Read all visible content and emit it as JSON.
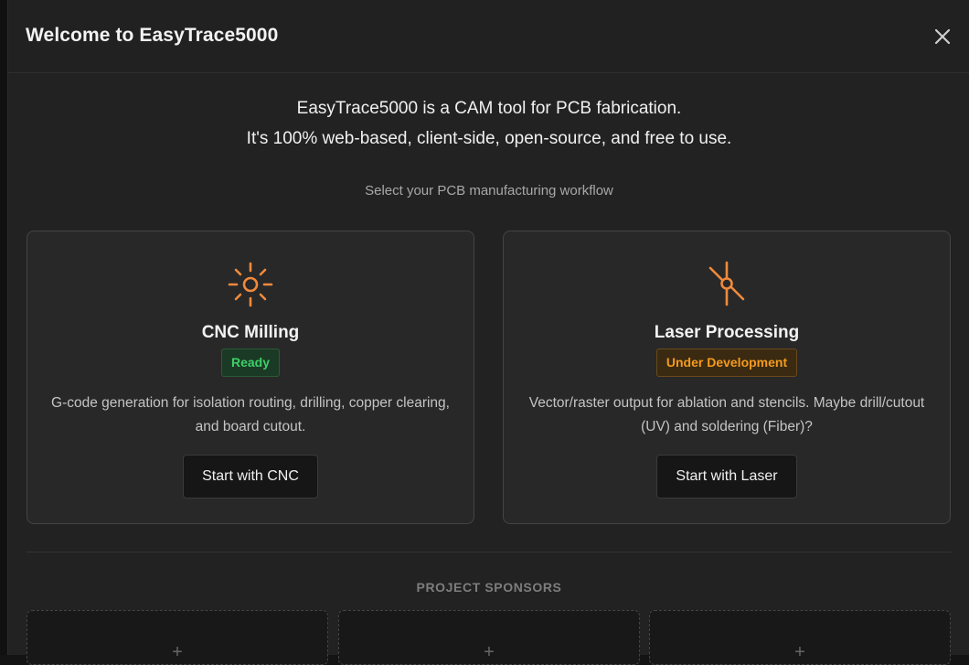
{
  "modal": {
    "title": "Welcome to EasyTrace5000",
    "close_icon": "close-icon"
  },
  "intro": {
    "line1": "EasyTrace5000 is a CAM tool for PCB fabrication.",
    "line2": "It's 100% web-based, client-side, open-source, and free to use."
  },
  "workflow_prompt": "Select your PCB manufacturing workflow",
  "workflows": [
    {
      "icon": "sun-icon",
      "title": "CNC Milling",
      "badge": "Ready",
      "badge_color": "#3ecf68",
      "description": "G-code generation for isolation routing, drilling, copper clearing, and board cutout.",
      "button": "Start with CNC"
    },
    {
      "icon": "laser-icon",
      "title": "Laser Processing",
      "badge": "Under Development",
      "badge_color": "#f59a1e",
      "description": "Vector/raster output for ablation and stencils. Maybe drill/cutout (UV) and soldering (Fiber)?",
      "button": "Start with Laser"
    }
  ],
  "sponsors": {
    "label": "PROJECT SPONSORS",
    "slots": [
      "+",
      "+",
      "+"
    ]
  },
  "colors": {
    "accent": "#f08a3c",
    "background": "#222222"
  }
}
